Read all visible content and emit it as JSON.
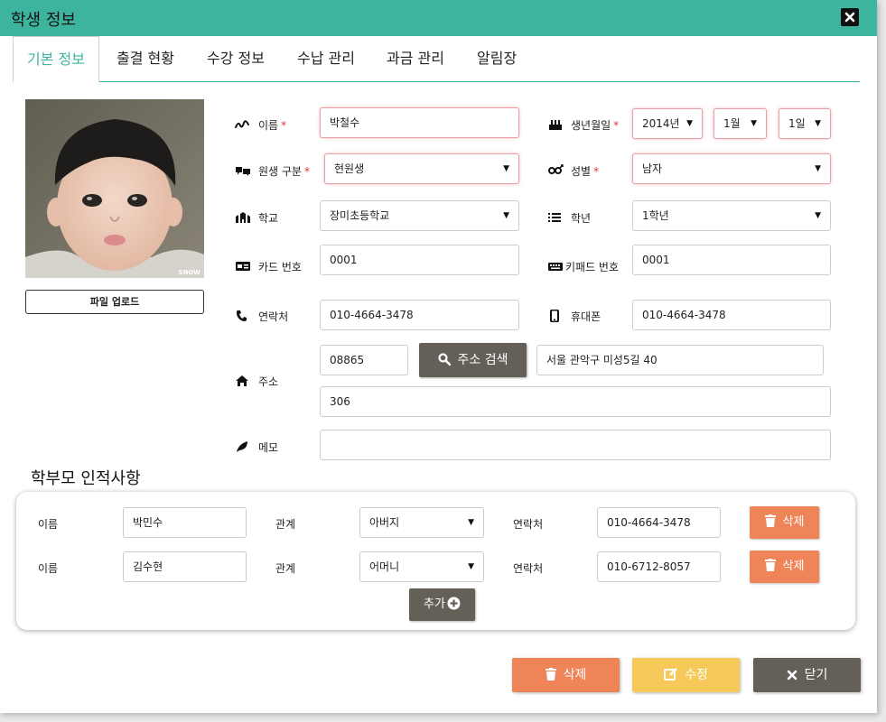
{
  "window": {
    "title": "학생 정보"
  },
  "tabs": [
    "기본 정보",
    "출결 현황",
    "수강 정보",
    "수납 관리",
    "과금 관리",
    "알림장"
  ],
  "photo": {
    "watermark": "SNOW",
    "upload_label": "파일 업로드"
  },
  "form": {
    "name_label": "이름",
    "name_value": "박철수",
    "birth_label": "생년월일",
    "birth_year": "2014년",
    "birth_month": "1월",
    "birth_day": "1일",
    "student_type_label": "원생 구분",
    "student_type_value": "현원생",
    "gender_label": "성별",
    "gender_value": "남자",
    "school_label": "학교",
    "school_value": "장미초등학교",
    "grade_label": "학년",
    "grade_value": "1학년",
    "card_label": "카드 번호",
    "card_value": "0001",
    "keypad_label": "키패드 번호",
    "keypad_value": "0001",
    "contact_label": "연락처",
    "contact_value": "010-4664-3478",
    "mobile_label": "휴대폰",
    "mobile_value": "010-4664-3478",
    "address_label": "주소",
    "zipcode_value": "08865",
    "address_search_label": "주소 검색",
    "address_value": "서울 관악구 미성5길 40",
    "address_detail_value": "306",
    "memo_label": "메모",
    "memo_value": "",
    "required_mark": "*"
  },
  "parents": {
    "section_title": "학부모 인적사항",
    "name_label": "이름",
    "relation_label": "관계",
    "contact_label": "연락처",
    "delete_label": "삭제",
    "add_label": "추가",
    "rows": [
      {
        "name": "박민수",
        "relation": "아버지",
        "contact": "010-4664-3478"
      },
      {
        "name": "김수현",
        "relation": "어머니",
        "contact": "010-6712-8057"
      }
    ]
  },
  "footer": {
    "delete_label": "삭제",
    "edit_label": "수정",
    "close_label": "닫기"
  },
  "colors": {
    "accent": "#3db59e",
    "delete": "#ee8458",
    "edit": "#f6c95a",
    "dark": "#646058",
    "error_border": "#e8a0a8",
    "required": "#d33333"
  },
  "select_arrow": "▼"
}
